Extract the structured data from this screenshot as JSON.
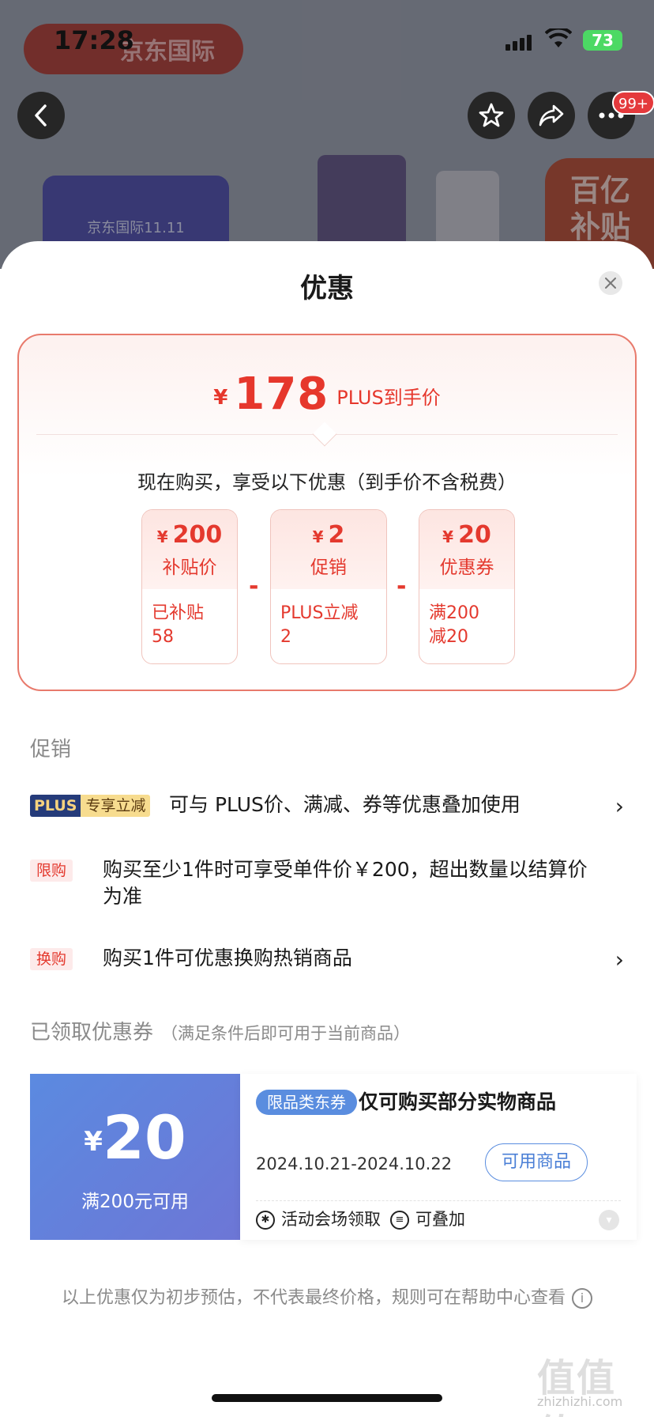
{
  "status_bar": {
    "time": "17:28",
    "battery": "73"
  },
  "background_page": {
    "banner_text": "京东国际",
    "notification_count": "99+",
    "promo_card_text": "京东国际11.11",
    "subsidy_badge": [
      "百亿",
      "补贴"
    ]
  },
  "sheet": {
    "title": "优惠",
    "price_summary": {
      "currency": "¥",
      "final_price": "178",
      "final_label": "PLUS到手价",
      "description": "现在购买，享受以下优惠（到手价不含税费）",
      "operator": "-",
      "breakdown": [
        {
          "amount": "200",
          "type": "补贴价",
          "detail_line1": "已补贴",
          "detail_line2": "58"
        },
        {
          "amount": "2",
          "type": "促销",
          "detail_line1": "PLUS立减",
          "detail_line2": "2"
        },
        {
          "amount": "20",
          "type": "优惠券",
          "detail_line1": "满200",
          "detail_line2": "减20"
        }
      ]
    },
    "promotions": {
      "section_title": "促销",
      "items": [
        {
          "tag_plus": "PLUS",
          "tag": "专享立减",
          "text": "可与 PLUS价、满减、券等优惠叠加使用",
          "has_arrow": true
        },
        {
          "tag": "限购",
          "text": "购买至少1件时可享受单件价￥200，超出数量以结算价为准",
          "has_arrow": false
        },
        {
          "tag": "换购",
          "text": "购买1件可优惠换购热销商品",
          "has_arrow": true
        }
      ],
      "arrow": "›"
    },
    "coupons": {
      "section_title": "已领取优惠券",
      "section_note": "（满足条件后即可用于当前商品）",
      "items": [
        {
          "currency": "¥",
          "amount": "20",
          "condition": "满200元可用",
          "tag": "限品类东券",
          "title": "仅可购买部分实物商品",
          "validity": "2024.10.21-2024.10.22",
          "button": "可用商品",
          "source": "活动会场领取",
          "stackable": "可叠加"
        }
      ]
    },
    "footnote": "以上优惠仅为初步预估，不代表最终价格，规则可在帮助中心查看",
    "watermark": "值值值",
    "watermark_url": "zhizhizhi.com"
  },
  "colors": {
    "accent_red": "#e4392e",
    "coupon_blue": "#5b8ae0",
    "plus_navy": "#253b7a"
  }
}
